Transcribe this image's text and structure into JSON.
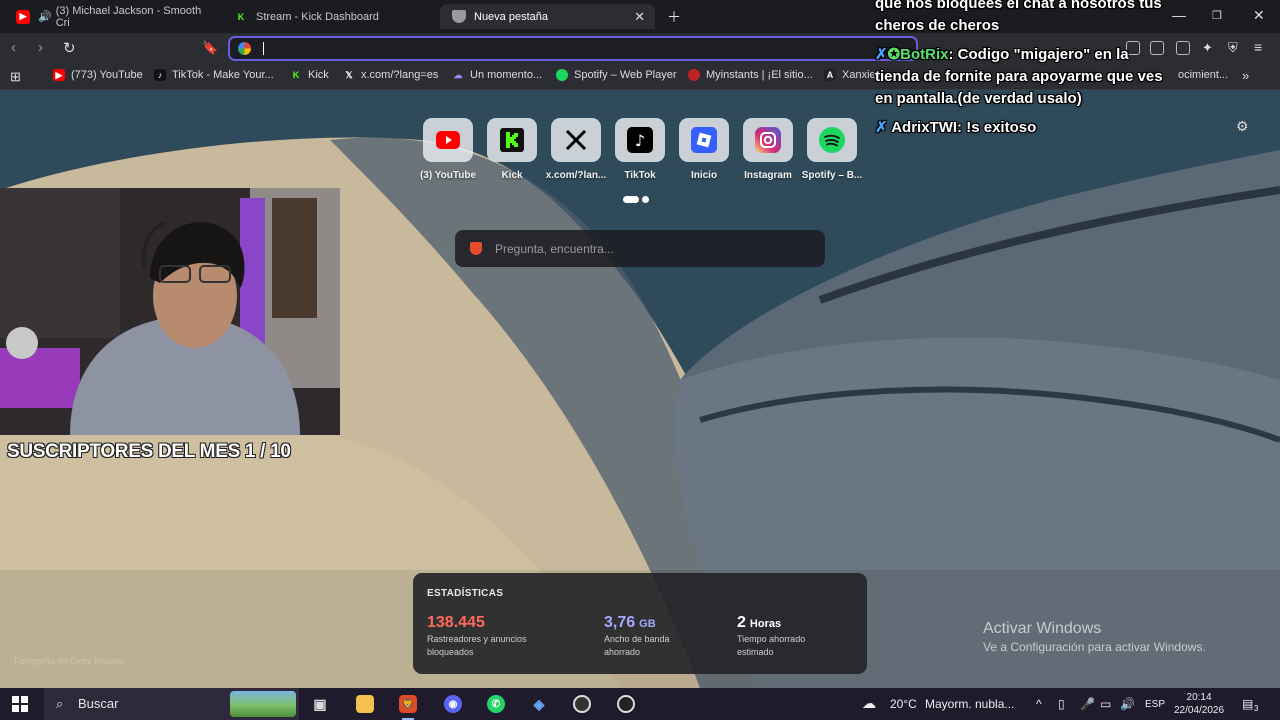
{
  "tabs": [
    {
      "label": "(3) Michael Jackson - Smooth Cri",
      "icon": "youtube-icon",
      "audio": true
    },
    {
      "label": "Stream - Kick Dashboard",
      "icon": "kick-icon"
    },
    {
      "label": "Nueva pestaña",
      "icon": "brave-shield-icon",
      "active": true
    }
  ],
  "omnibox": {
    "value": ""
  },
  "bookmarks": [
    {
      "label": "(773) YouTube",
      "icon": "youtube-icon"
    },
    {
      "label": "TikTok - Make Your...",
      "icon": "tiktok-icon"
    },
    {
      "label": "Kick",
      "icon": "kick-icon"
    },
    {
      "label": "x.com/?lang=es",
      "icon": "x-icon"
    },
    {
      "label": "Un momento...",
      "icon": "cloud-icon"
    },
    {
      "label": "Spotify – Web Player",
      "icon": "spotify-icon"
    },
    {
      "label": "Myinstants | ¡El sitio...",
      "icon": "myinstants-icon"
    },
    {
      "label": "Xanxie",
      "icon": "a-icon"
    },
    {
      "label": "ocimient...",
      "icon": "folder-icon"
    }
  ],
  "shortcuts": [
    {
      "label": "(3) YouTube",
      "icon": "youtube-icon"
    },
    {
      "label": "Kick",
      "icon": "kick-icon"
    },
    {
      "label": "x.com/?lan...",
      "icon": "x-icon"
    },
    {
      "label": "TikTok",
      "icon": "tiktok-icon"
    },
    {
      "label": "Inicio",
      "icon": "roblox-icon"
    },
    {
      "label": "Instagram",
      "icon": "instagram-icon"
    },
    {
      "label": "Spotify – B...",
      "icon": "spotify-icon"
    }
  ],
  "search": {
    "placeholder": "Pregunta, encuentra..."
  },
  "stats": {
    "title": "ESTADÍSTICAS",
    "items": [
      {
        "value": "138.445",
        "unit": "",
        "desc1": "Rastreadores y anuncios",
        "desc2": "bloqueados",
        "color": "#ff6a5a"
      },
      {
        "value": "3,76",
        "unit": "GB",
        "desc1": "Ancho de banda",
        "desc2": "ahorrado",
        "color": "#a6a8ff"
      },
      {
        "value": "2",
        "unit": "Horas",
        "desc1": "Tiempo ahorrado",
        "desc2": "estimado",
        "color": "#ffffff"
      }
    ]
  },
  "overlay": {
    "subs": "SUSCRIPTORES DEL MES 1 / 10",
    "chat": [
      {
        "text": "que nos bloquees el chat a nosotros tus"
      },
      {
        "text": "cheros de cheros"
      },
      {
        "user": "BotRix",
        "text": "Codigo \"migajero\" en la"
      },
      {
        "text": "tienda de fornite para apoyarme que ves"
      },
      {
        "text": "en pantalla.(de verdad usalo)"
      },
      {
        "user": "AdrixTWI",
        "text": "!s exitoso"
      }
    ]
  },
  "activate": {
    "line1": "Activar Windows",
    "line2": "Ve a Configuración para activar Windows."
  },
  "credit": "Fotografía de Getty Images",
  "taskbar": {
    "search": "Buscar",
    "weather": "20°C",
    "weather_desc": "Mayorm. nubla...",
    "lang": "ESP",
    "time": "20:14",
    "date": "22/04/2026",
    "notif": "3"
  }
}
